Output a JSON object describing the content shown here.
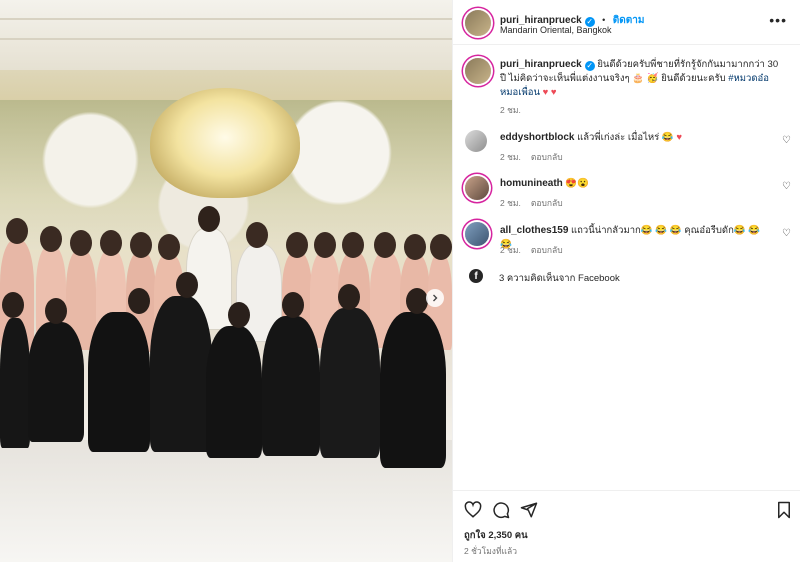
{
  "post": {
    "author": "puri_hiranprueck",
    "follow_label": "ติดตาม",
    "separator": "•",
    "location": "Mandarin Oriental, Bangkok",
    "more_icon": "more-horizontal-icon"
  },
  "caption": {
    "username": "puri_hiranprueck",
    "text": "ยินดีด้วยครับพี่ชายที่รักรู้จักกันมามากกว่า 30 ปี ไม่คิดว่าจะเห็นพี่แต่งงานจริงๆ 🎂 🥳 ยินดีด้วยนะครับ",
    "hashtag": "#หมวดอ๋อหมอเพื่อน",
    "time": "2 ชม."
  },
  "comments": [
    {
      "username": "eddyshortblock",
      "text": "แล้วพี่เก่งล่ะ เมื่อไหร่ 😂",
      "time": "2 ชม.",
      "reply": "ตอบกลับ"
    },
    {
      "username": "homunineath",
      "text": "😍😮",
      "time": "2 ชม.",
      "reply": "ตอบกลับ"
    },
    {
      "username": "all_clothes159",
      "text": "แถวนี้น่ากลัวมาก😂 😂 😂 คุณอ๋อรีบดัก😂 😂 😂",
      "time": "2 ชม.",
      "reply": "ตอบกลับ"
    }
  ],
  "facebook": {
    "text": "3 ความคิดเห็นจาก Facebook"
  },
  "engagement": {
    "likes": "ถูกใจ 2,350 คน",
    "posted": "2 ชั่วโมงที่แล้ว"
  },
  "colors": {
    "accent": "#0095f6",
    "heart": "#ed4956",
    "muted": "#737373"
  }
}
